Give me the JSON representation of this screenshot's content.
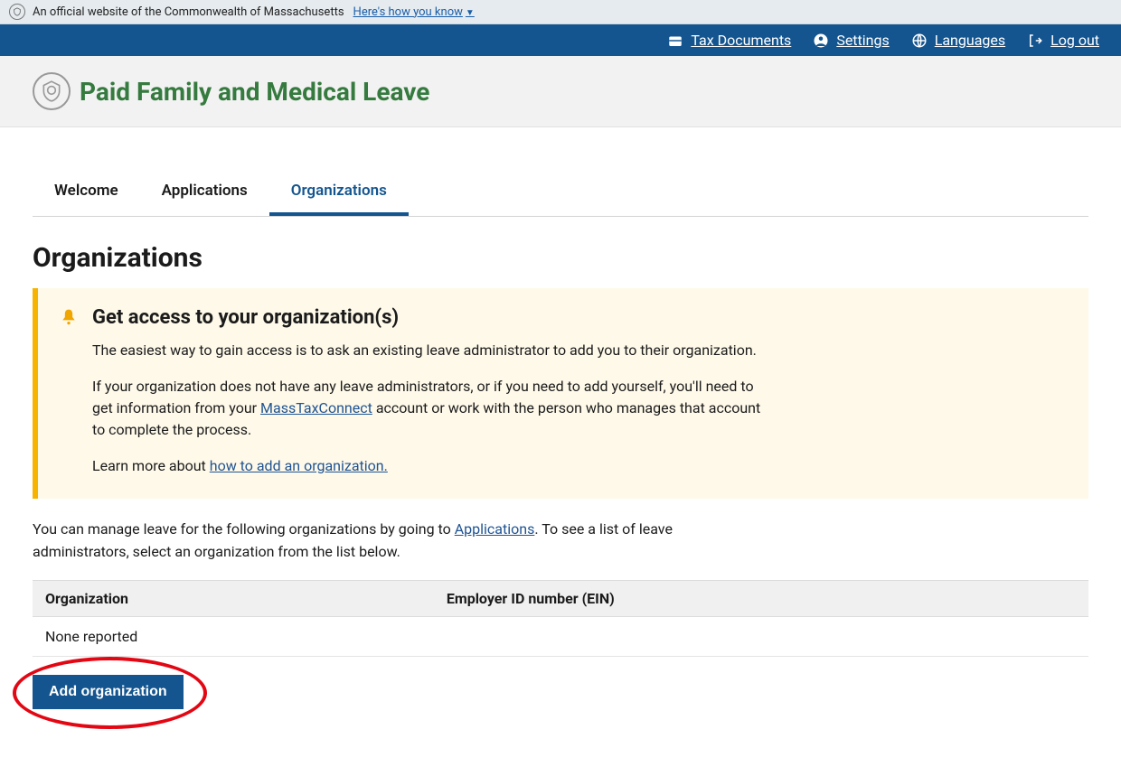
{
  "banner": {
    "text": "An official website of the Commonwealth of Massachusetts",
    "how_link": "Here's how you know"
  },
  "topnav": {
    "tax_docs": "Tax Documents",
    "settings": "Settings",
    "languages": "Languages",
    "logout": "Log out"
  },
  "header": {
    "title": "Paid Family and Medical Leave"
  },
  "tabs": {
    "welcome": "Welcome",
    "applications": "Applications",
    "organizations": "Organizations"
  },
  "page": {
    "title": "Organizations"
  },
  "alert": {
    "heading": "Get access to your organization(s)",
    "p1": "The easiest way to gain access is to ask an existing leave administrator to add you to their organization.",
    "p2a": "If your organization does not have any leave administrators, or if you need to add yourself, you'll need to get information from your ",
    "p2_link": "MassTaxConnect",
    "p2b": " account or work with the person who manages that account to complete the process.",
    "p3a": "Learn more about ",
    "p3_link": "how to add an organization."
  },
  "body": {
    "line_a": "You can manage leave for the following organizations by going to ",
    "line_link": "Applications",
    "line_b": ". To see a list of leave administrators, select an organization from the list below."
  },
  "table": {
    "col_org": "Organization",
    "col_ein": "Employer ID number (EIN)",
    "none": "None reported"
  },
  "buttons": {
    "add_org": "Add organization"
  }
}
